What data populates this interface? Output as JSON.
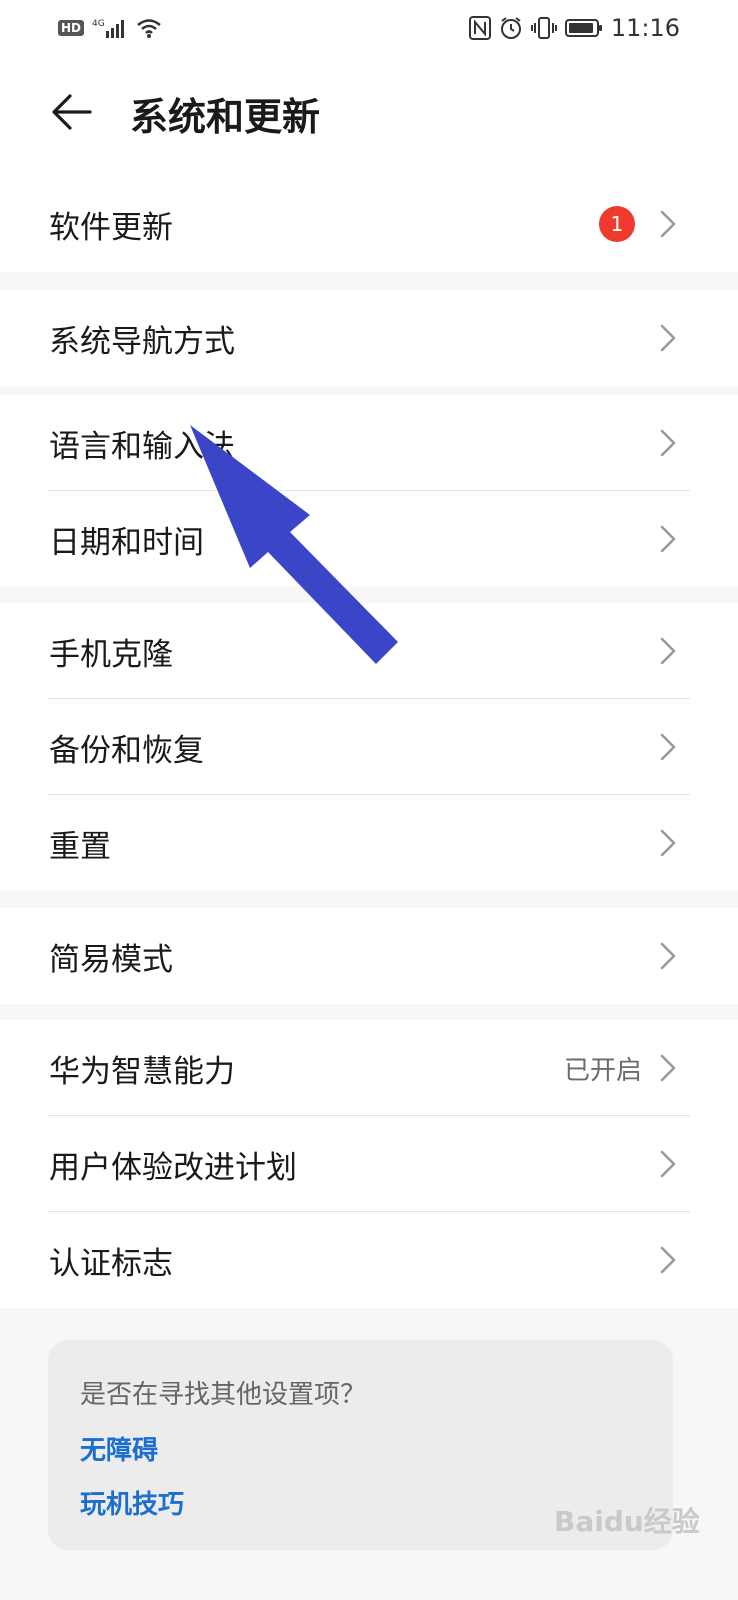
{
  "status_bar": {
    "network": "4G",
    "hd": "HD",
    "time": "11:16"
  },
  "header": {
    "title": "系统和更新"
  },
  "groups": [
    {
      "items": [
        {
          "label": "软件更新",
          "badge": "1"
        }
      ]
    },
    {
      "items": [
        {
          "label": "系统导航方式"
        }
      ]
    },
    {
      "items": [
        {
          "label": "语言和输入法"
        },
        {
          "label": "日期和时间"
        }
      ]
    },
    {
      "items": [
        {
          "label": "手机克隆"
        },
        {
          "label": "备份和恢复"
        },
        {
          "label": "重置"
        }
      ]
    },
    {
      "items": [
        {
          "label": "简易模式"
        }
      ]
    },
    {
      "items": [
        {
          "label": "华为智慧能力",
          "value": "已开启"
        },
        {
          "label": "用户体验改进计划"
        },
        {
          "label": "认证标志"
        }
      ]
    }
  ],
  "suggestions": {
    "title": "是否在寻找其他设置项？",
    "links": [
      "无障碍",
      "玩机技巧"
    ]
  },
  "watermark": "Baidu经验",
  "colors": {
    "badge": "#ef3b2d",
    "link": "#1c6fd1",
    "annotation_arrow": "#3a45c8"
  }
}
